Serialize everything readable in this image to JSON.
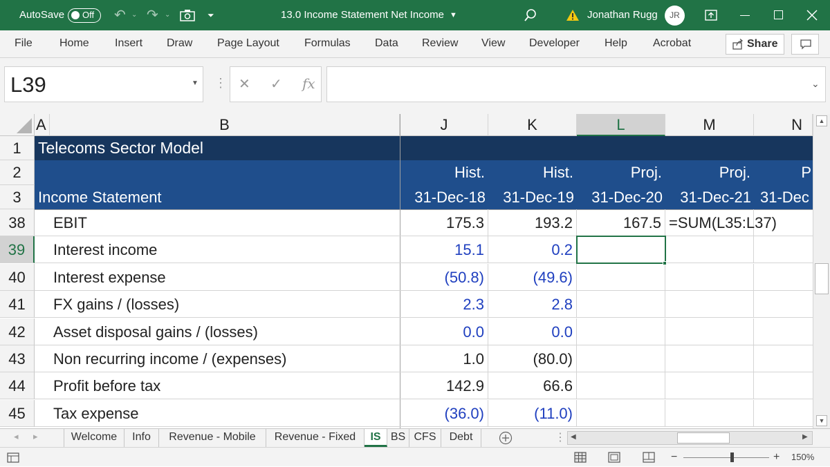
{
  "titlebar": {
    "autosave_label": "AutoSave",
    "autosave_state": "Off",
    "doc_title": "13.0 Income Statement Net Income",
    "user_name": "Jonathan Rugg",
    "user_initials": "JR"
  },
  "ribbon": {
    "tabs": [
      "File",
      "Home",
      "Insert",
      "Draw",
      "Page Layout",
      "Formulas",
      "Data",
      "Review",
      "View",
      "Developer",
      "Help",
      "Acrobat"
    ],
    "share_label": "Share"
  },
  "formula_bar": {
    "name_box": "L39",
    "fx_label": "fx",
    "formula": ""
  },
  "columns": [
    "A",
    "B",
    "J",
    "K",
    "L",
    "M",
    "N"
  ],
  "header_rows": {
    "r1": {
      "num": "1",
      "title": "Telecoms Sector Model"
    },
    "r2": {
      "num": "2",
      "J": "Hist.",
      "K": "Hist.",
      "L": "Proj.",
      "M": "Proj.",
      "N": "P"
    },
    "r3": {
      "num": "3",
      "label": "Income Statement",
      "J": "31-Dec-18",
      "K": "31-Dec-19",
      "L": "31-Dec-20",
      "M": "31-Dec-21",
      "N": "31-Dec"
    }
  },
  "rows": [
    {
      "num": "38",
      "label": "EBIT",
      "J": "175.3",
      "K": "193.2",
      "L": "167.5",
      "M": "=SUM(L35:L37)"
    },
    {
      "num": "39",
      "label": "Interest income",
      "J": "15.1",
      "K": "0.2",
      "L": "",
      "M": ""
    },
    {
      "num": "40",
      "label": "Interest expense",
      "J": "(50.8)",
      "K": "(49.6)",
      "L": "",
      "M": ""
    },
    {
      "num": "41",
      "label": "FX gains / (losses)",
      "J": "2.3",
      "K": "2.8",
      "L": "",
      "M": ""
    },
    {
      "num": "42",
      "label": "Asset disposal gains / (losses)",
      "J": "0.0",
      "K": "0.0",
      "L": "",
      "M": ""
    },
    {
      "num": "43",
      "label": "Non recurring income / (expenses)",
      "J": "1.0",
      "K": "(80.0)",
      "L": "",
      "M": ""
    },
    {
      "num": "44",
      "label": "Profit before tax",
      "J": "142.9",
      "K": "66.6",
      "L": "",
      "M": ""
    },
    {
      "num": "45",
      "label": "Tax expense",
      "J": "(36.0)",
      "K": "(11.0)",
      "L": "",
      "M": ""
    }
  ],
  "sheet_tabs": [
    "Welcome",
    "Info",
    "Revenue - Mobile",
    "Revenue - Fixed",
    "IS",
    "BS",
    "CFS",
    "Debt"
  ],
  "active_sheet": "IS",
  "status": {
    "zoom": "150%"
  },
  "colors": {
    "excel_green": "#217346",
    "header_dark": "#17365d",
    "header_mid": "#1f4e8c",
    "input_blue": "#1f3fbf"
  }
}
